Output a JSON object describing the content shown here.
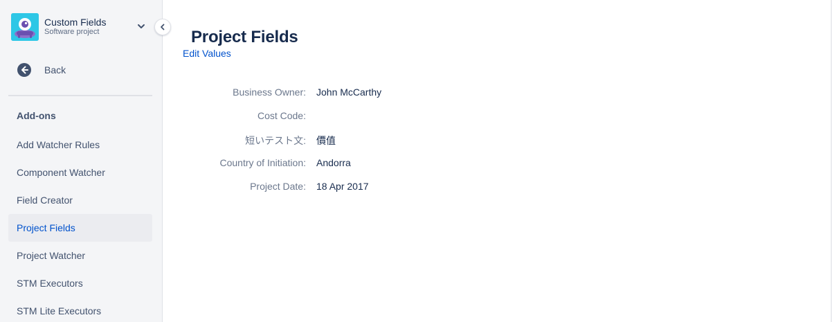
{
  "project": {
    "name": "Custom Fields",
    "type": "Software project",
    "avatar_color": "#2ec7e6"
  },
  "sidebar": {
    "back_label": "Back",
    "section_title": "Add-ons",
    "items": [
      {
        "label": "Add Watcher Rules",
        "selected": false
      },
      {
        "label": "Component Watcher",
        "selected": false
      },
      {
        "label": "Field Creator",
        "selected": false
      },
      {
        "label": "Project Fields",
        "selected": true
      },
      {
        "label": "Project Watcher",
        "selected": false
      },
      {
        "label": "STM Executors",
        "selected": false
      },
      {
        "label": "STM Lite Executors",
        "selected": false
      }
    ],
    "icons": {
      "collapse": "chevron-left-icon",
      "back": "arrow-left-circle-icon",
      "dropdown": "chevron-down-icon"
    }
  },
  "main": {
    "title": "Project Fields",
    "edit_link": "Edit Values",
    "fields": [
      {
        "label": "Business Owner:",
        "value": "John McCarthy"
      },
      {
        "label": "Cost Code:",
        "value": ""
      },
      {
        "label": "短いテスト文:",
        "value": "價值"
      },
      {
        "label": "Country of Initiation:",
        "value": "Andorra"
      },
      {
        "label": "Project Date:",
        "value": "18 Apr 2017"
      }
    ]
  },
  "colors": {
    "link": "#0052cc",
    "sidebar_bg": "#f4f5f7",
    "selected_bg": "#ebecf0",
    "text": "#172b4d",
    "label": "#6b778c"
  }
}
